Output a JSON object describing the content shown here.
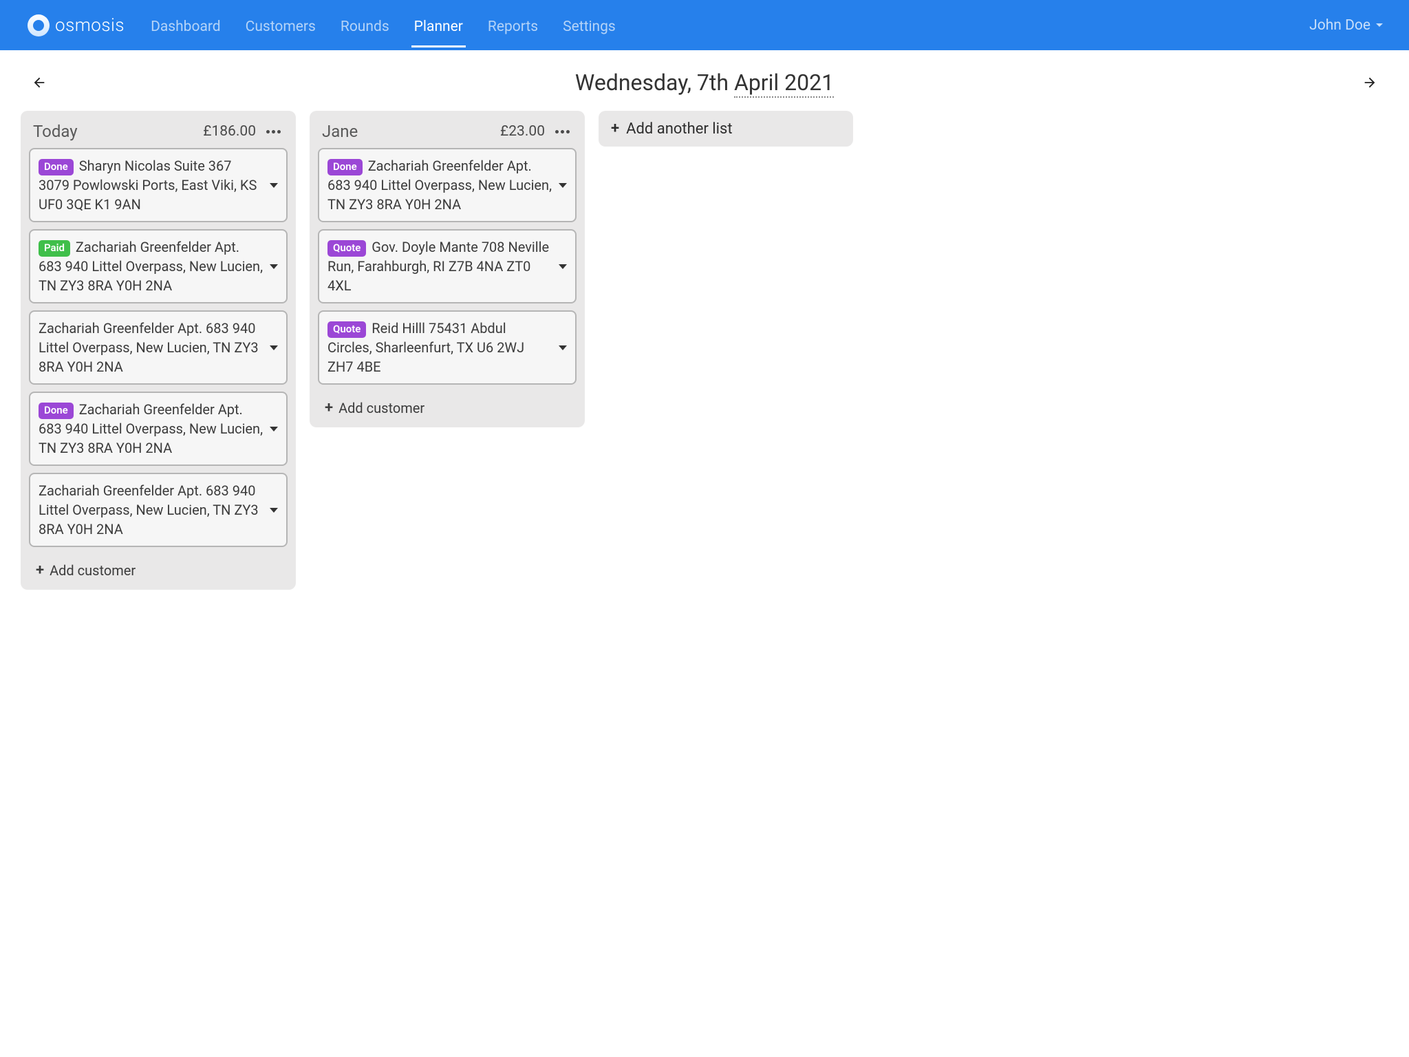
{
  "brand": "osmosis",
  "nav": {
    "items": [
      {
        "label": "Dashboard",
        "active": false
      },
      {
        "label": "Customers",
        "active": false
      },
      {
        "label": "Rounds",
        "active": false
      },
      {
        "label": "Planner",
        "active": true
      },
      {
        "label": "Reports",
        "active": false
      },
      {
        "label": "Settings",
        "active": false
      }
    ],
    "user": "John Doe"
  },
  "date": {
    "weekday_day": "Wednesday, 7th ",
    "month_year": "April 2021"
  },
  "lists": [
    {
      "title": "Today",
      "total": "£186.00",
      "cards": [
        {
          "badge": "Done",
          "badgeClass": "done",
          "text": "Sharyn Nicolas Suite 367 3079 Powlowski Ports, East Viki, KS UF0 3QE K1 9AN"
        },
        {
          "badge": "Paid",
          "badgeClass": "paid",
          "text": "Zachariah Greenfelder Apt. 683 940 Littel Overpass, New Lucien, TN ZY3 8RA Y0H 2NA"
        },
        {
          "badge": null,
          "badgeClass": null,
          "text": "Zachariah Greenfelder Apt. 683 940 Littel Overpass, New Lucien, TN ZY3 8RA Y0H 2NA"
        },
        {
          "badge": "Done",
          "badgeClass": "done",
          "text": "Zachariah Greenfelder Apt. 683 940 Littel Overpass, New Lucien, TN ZY3 8RA Y0H 2NA"
        },
        {
          "badge": null,
          "badgeClass": null,
          "text": "Zachariah Greenfelder Apt. 683 940 Littel Overpass, New Lucien, TN ZY3 8RA Y0H 2NA"
        }
      ]
    },
    {
      "title": "Jane",
      "total": "£23.00",
      "cards": [
        {
          "badge": "Done",
          "badgeClass": "done",
          "text": "Zachariah Greenfelder Apt. 683 940 Littel Overpass, New Lucien, TN ZY3 8RA Y0H 2NA"
        },
        {
          "badge": "Quote",
          "badgeClass": "quote",
          "text": "Gov. Doyle Mante 708 Neville Run, Farahburgh, RI Z7B 4NA ZT0 4XL"
        },
        {
          "badge": "Quote",
          "badgeClass": "quote",
          "text": "Reid Hilll 75431 Abdul Circles, Sharleenfurt, TX U6 2WJ ZH7 4BE"
        }
      ]
    }
  ],
  "strings": {
    "add_customer": "Add customer",
    "add_list": "Add another list"
  }
}
